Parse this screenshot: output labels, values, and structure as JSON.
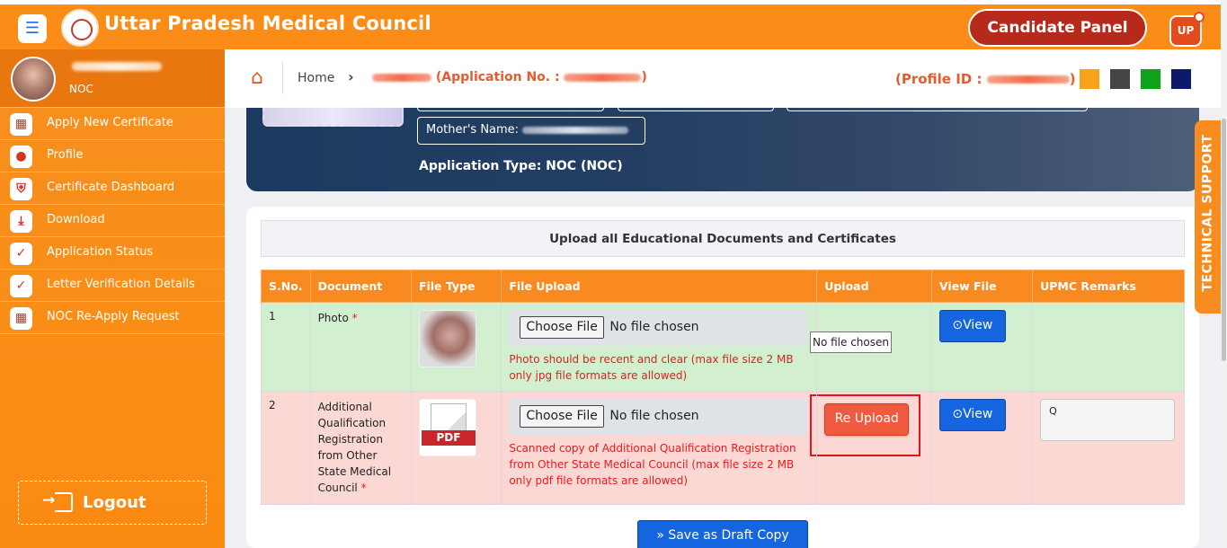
{
  "header": {
    "title": "Uttar Pradesh Medical Council",
    "panel_button": "Candidate Panel",
    "badge": "UP",
    "menu_icon": "hamburger-icon"
  },
  "sidebar": {
    "role": "NOC",
    "items": [
      {
        "label": "Apply New Certificate",
        "icon": "grid-icon"
      },
      {
        "label": "Profile",
        "icon": "user-icon"
      },
      {
        "label": "Certificate Dashboard",
        "icon": "shield-icon"
      },
      {
        "label": "Download",
        "icon": "download-icon"
      },
      {
        "label": "Application Status",
        "icon": "check-circle-icon"
      },
      {
        "label": "Letter Verification Details",
        "icon": "check-circle-icon"
      },
      {
        "label": "NOC Re-Apply Request",
        "icon": "grid-icon"
      }
    ],
    "logout": "Logout"
  },
  "breadcrumb": {
    "home": "Home",
    "app_no_label": "(Application No. :",
    "app_no_close": ")",
    "profile_label": "(Profile ID :",
    "profile_close": ")",
    "swatches": [
      "#f7a21b",
      "#444444",
      "#0da218",
      "#0d1a6b"
    ]
  },
  "hero": {
    "mother_label": "Mother's Name:",
    "app_type": "Application Type: NOC (NOC)"
  },
  "upload": {
    "title": "Upload all Educational Documents and Certificates",
    "columns": [
      "S.No.",
      "Document",
      "File Type",
      "File Upload",
      "Upload",
      "View File",
      "UPMC Remarks"
    ],
    "rows": [
      {
        "sno": "1",
        "document": "Photo",
        "required_mark": "*",
        "choose_label": "Choose File",
        "file_status": "No file chosen",
        "hint": "Photo should be recent and clear (max file size 2 MB only jpg file formats are allowed)",
        "view_label": "View",
        "remarks": ""
      },
      {
        "sno": "2",
        "document": "Additional Qualification Registration from Other State Medical Council",
        "required_mark": "*",
        "choose_label": "Choose File",
        "file_status": "No file chosen",
        "hint": "Scanned copy of Additional Qualification Registration from Other State Medical Council (max file size 2 MB only pdf file formats are allowed)",
        "upload_label": "Re Upload",
        "view_label": "View",
        "remarks": "Q",
        "pdf_label": "PDF"
      }
    ],
    "tooltip": "No file chosen",
    "save_label": "Save as Draft Copy",
    "save_icon": "double-chevron-right-icon"
  },
  "tech_support": "TECHNICAL SUPPORT"
}
